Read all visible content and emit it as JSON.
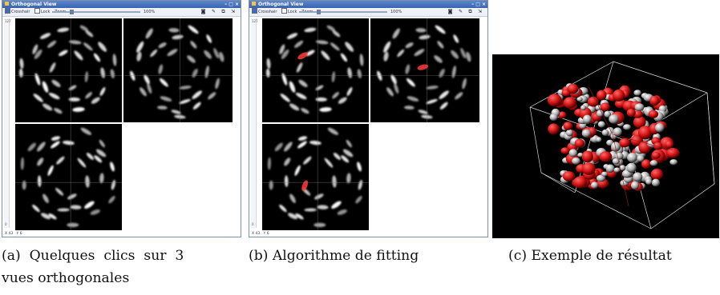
{
  "window_title": "Orthogonal View",
  "window_controls": "– □ ×",
  "toolbar": {
    "crosshair_label": "Crosshair",
    "lock_label": "Lock",
    "zoom_label": "Zoom",
    "zoom_value": "100%"
  },
  "ruler": {
    "top": "127",
    "bottom": "0"
  },
  "status": {
    "left": "X 43",
    "right": "Y 6"
  },
  "captions": {
    "a_line1": "(a)  Quelques  clics  sur  3",
    "a_line2": "vues orthogonales",
    "b": "(b) Algorithme de fitting",
    "c": "(c) Exemple de résultat"
  },
  "colors": {
    "titlebar": "#3a63ad",
    "highlight": "#ff3b3b",
    "background": "#000000"
  }
}
